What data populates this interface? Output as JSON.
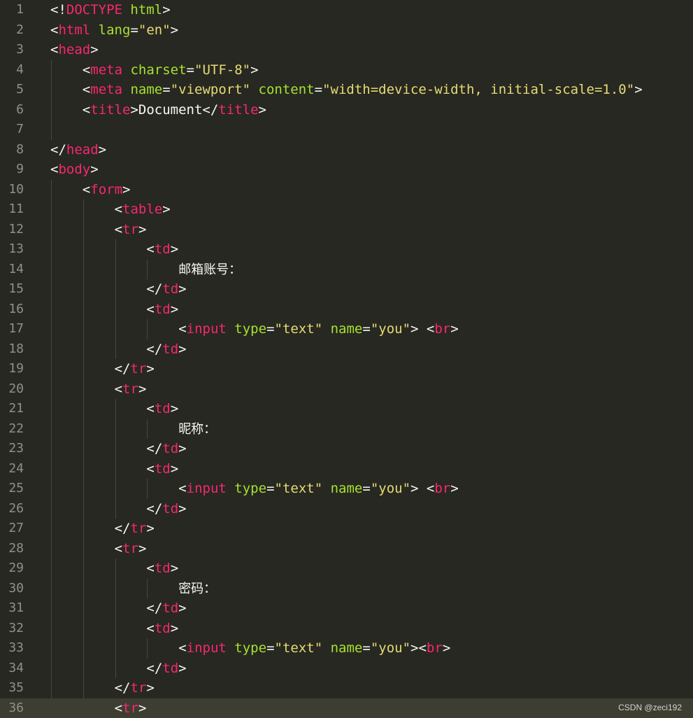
{
  "editor": {
    "language": "html",
    "current_line": 36,
    "lines": [
      {
        "n": "1",
        "indent": 0,
        "tokens": [
          {
            "t": "punct",
            "v": "<!"
          },
          {
            "t": "tag",
            "v": "DOCTYPE"
          },
          {
            "t": "punct",
            "v": " "
          },
          {
            "t": "attr",
            "v": "html"
          },
          {
            "t": "punct",
            "v": ">"
          }
        ]
      },
      {
        "n": "2",
        "indent": 0,
        "tokens": [
          {
            "t": "punct",
            "v": "<"
          },
          {
            "t": "tag",
            "v": "html"
          },
          {
            "t": "punct",
            "v": " "
          },
          {
            "t": "attr",
            "v": "lang"
          },
          {
            "t": "punct",
            "v": "="
          },
          {
            "t": "str",
            "v": "\"en\""
          },
          {
            "t": "punct",
            "v": ">"
          }
        ]
      },
      {
        "n": "3",
        "indent": 0,
        "tokens": [
          {
            "t": "punct",
            "v": "<"
          },
          {
            "t": "tag",
            "v": "head"
          },
          {
            "t": "punct",
            "v": ">"
          }
        ]
      },
      {
        "n": "4",
        "indent": 1,
        "tokens": [
          {
            "t": "punct",
            "v": "<"
          },
          {
            "t": "tag",
            "v": "meta"
          },
          {
            "t": "punct",
            "v": " "
          },
          {
            "t": "attr",
            "v": "charset"
          },
          {
            "t": "punct",
            "v": "="
          },
          {
            "t": "str",
            "v": "\"UTF-8\""
          },
          {
            "t": "punct",
            "v": ">"
          }
        ]
      },
      {
        "n": "5",
        "indent": 1,
        "tokens": [
          {
            "t": "punct",
            "v": "<"
          },
          {
            "t": "tag",
            "v": "meta"
          },
          {
            "t": "punct",
            "v": " "
          },
          {
            "t": "attr",
            "v": "name"
          },
          {
            "t": "punct",
            "v": "="
          },
          {
            "t": "str",
            "v": "\"viewport\""
          },
          {
            "t": "punct",
            "v": " "
          },
          {
            "t": "attr",
            "v": "content"
          },
          {
            "t": "punct",
            "v": "="
          },
          {
            "t": "str",
            "v": "\"width=device-width, initial-scale=1.0\""
          },
          {
            "t": "punct",
            "v": ">"
          }
        ]
      },
      {
        "n": "6",
        "indent": 1,
        "tokens": [
          {
            "t": "punct",
            "v": "<"
          },
          {
            "t": "tag",
            "v": "title"
          },
          {
            "t": "punct",
            "v": ">"
          },
          {
            "t": "text",
            "v": "Document"
          },
          {
            "t": "punct",
            "v": "</"
          },
          {
            "t": "tag",
            "v": "title"
          },
          {
            "t": "punct",
            "v": ">"
          }
        ]
      },
      {
        "n": "7",
        "indent": 1,
        "tokens": []
      },
      {
        "n": "8",
        "indent": 0,
        "tokens": [
          {
            "t": "punct",
            "v": "</"
          },
          {
            "t": "tag",
            "v": "head"
          },
          {
            "t": "punct",
            "v": ">"
          }
        ]
      },
      {
        "n": "9",
        "indent": 0,
        "tokens": [
          {
            "t": "punct",
            "v": "<"
          },
          {
            "t": "tag",
            "v": "body"
          },
          {
            "t": "punct",
            "v": ">"
          }
        ]
      },
      {
        "n": "10",
        "indent": 1,
        "tokens": [
          {
            "t": "punct",
            "v": "<"
          },
          {
            "t": "tag",
            "v": "form"
          },
          {
            "t": "punct",
            "v": ">"
          }
        ]
      },
      {
        "n": "11",
        "indent": 2,
        "tokens": [
          {
            "t": "punct",
            "v": "<"
          },
          {
            "t": "tag",
            "v": "table"
          },
          {
            "t": "punct",
            "v": ">"
          }
        ]
      },
      {
        "n": "12",
        "indent": 2,
        "tokens": [
          {
            "t": "punct",
            "v": "<"
          },
          {
            "t": "tag",
            "v": "tr"
          },
          {
            "t": "punct",
            "v": ">"
          }
        ]
      },
      {
        "n": "13",
        "indent": 3,
        "tokens": [
          {
            "t": "punct",
            "v": "<"
          },
          {
            "t": "tag",
            "v": "td"
          },
          {
            "t": "punct",
            "v": ">"
          }
        ]
      },
      {
        "n": "14",
        "indent": 4,
        "tokens": [
          {
            "t": "cn",
            "v": "邮箱账号："
          }
        ]
      },
      {
        "n": "15",
        "indent": 3,
        "tokens": [
          {
            "t": "punct",
            "v": "</"
          },
          {
            "t": "tag",
            "v": "td"
          },
          {
            "t": "punct",
            "v": ">"
          }
        ]
      },
      {
        "n": "16",
        "indent": 3,
        "tokens": [
          {
            "t": "punct",
            "v": "<"
          },
          {
            "t": "tag",
            "v": "td"
          },
          {
            "t": "punct",
            "v": ">"
          }
        ]
      },
      {
        "n": "17",
        "indent": 4,
        "tokens": [
          {
            "t": "punct",
            "v": "<"
          },
          {
            "t": "tag",
            "v": "input"
          },
          {
            "t": "punct",
            "v": " "
          },
          {
            "t": "attr",
            "v": "type"
          },
          {
            "t": "punct",
            "v": "="
          },
          {
            "t": "str",
            "v": "\"text\""
          },
          {
            "t": "punct",
            "v": " "
          },
          {
            "t": "attr",
            "v": "name"
          },
          {
            "t": "punct",
            "v": "="
          },
          {
            "t": "str",
            "v": "\"you\""
          },
          {
            "t": "punct",
            "v": "> <"
          },
          {
            "t": "tag",
            "v": "br"
          },
          {
            "t": "punct",
            "v": ">"
          }
        ]
      },
      {
        "n": "18",
        "indent": 3,
        "tokens": [
          {
            "t": "punct",
            "v": "</"
          },
          {
            "t": "tag",
            "v": "td"
          },
          {
            "t": "punct",
            "v": ">"
          }
        ]
      },
      {
        "n": "19",
        "indent": 2,
        "tokens": [
          {
            "t": "punct",
            "v": "</"
          },
          {
            "t": "tag",
            "v": "tr"
          },
          {
            "t": "punct",
            "v": ">"
          }
        ]
      },
      {
        "n": "20",
        "indent": 2,
        "tokens": [
          {
            "t": "punct",
            "v": "<"
          },
          {
            "t": "tag",
            "v": "tr"
          },
          {
            "t": "punct",
            "v": ">"
          }
        ]
      },
      {
        "n": "21",
        "indent": 3,
        "tokens": [
          {
            "t": "punct",
            "v": "<"
          },
          {
            "t": "tag",
            "v": "td"
          },
          {
            "t": "punct",
            "v": ">"
          }
        ]
      },
      {
        "n": "22",
        "indent": 4,
        "tokens": [
          {
            "t": "cn",
            "v": "昵称："
          }
        ]
      },
      {
        "n": "23",
        "indent": 3,
        "tokens": [
          {
            "t": "punct",
            "v": "</"
          },
          {
            "t": "tag",
            "v": "td"
          },
          {
            "t": "punct",
            "v": ">"
          }
        ]
      },
      {
        "n": "24",
        "indent": 3,
        "tokens": [
          {
            "t": "punct",
            "v": "<"
          },
          {
            "t": "tag",
            "v": "td"
          },
          {
            "t": "punct",
            "v": ">"
          }
        ]
      },
      {
        "n": "25",
        "indent": 4,
        "tokens": [
          {
            "t": "punct",
            "v": "<"
          },
          {
            "t": "tag",
            "v": "input"
          },
          {
            "t": "punct",
            "v": " "
          },
          {
            "t": "attr",
            "v": "type"
          },
          {
            "t": "punct",
            "v": "="
          },
          {
            "t": "str",
            "v": "\"text\""
          },
          {
            "t": "punct",
            "v": " "
          },
          {
            "t": "attr",
            "v": "name"
          },
          {
            "t": "punct",
            "v": "="
          },
          {
            "t": "str",
            "v": "\"you\""
          },
          {
            "t": "punct",
            "v": "> <"
          },
          {
            "t": "tag",
            "v": "br"
          },
          {
            "t": "punct",
            "v": ">"
          }
        ]
      },
      {
        "n": "26",
        "indent": 3,
        "tokens": [
          {
            "t": "punct",
            "v": "</"
          },
          {
            "t": "tag",
            "v": "td"
          },
          {
            "t": "punct",
            "v": ">"
          }
        ]
      },
      {
        "n": "27",
        "indent": 2,
        "tokens": [
          {
            "t": "punct",
            "v": "</"
          },
          {
            "t": "tag",
            "v": "tr"
          },
          {
            "t": "punct",
            "v": ">"
          }
        ]
      },
      {
        "n": "28",
        "indent": 2,
        "tokens": [
          {
            "t": "punct",
            "v": "<"
          },
          {
            "t": "tag",
            "v": "tr"
          },
          {
            "t": "punct",
            "v": ">"
          }
        ]
      },
      {
        "n": "29",
        "indent": 3,
        "tokens": [
          {
            "t": "punct",
            "v": "<"
          },
          {
            "t": "tag",
            "v": "td"
          },
          {
            "t": "punct",
            "v": ">"
          }
        ]
      },
      {
        "n": "30",
        "indent": 4,
        "tokens": [
          {
            "t": "cn",
            "v": "密码："
          }
        ]
      },
      {
        "n": "31",
        "indent": 3,
        "tokens": [
          {
            "t": "punct",
            "v": "</"
          },
          {
            "t": "tag",
            "v": "td"
          },
          {
            "t": "punct",
            "v": ">"
          }
        ]
      },
      {
        "n": "32",
        "indent": 3,
        "tokens": [
          {
            "t": "punct",
            "v": "<"
          },
          {
            "t": "tag",
            "v": "td"
          },
          {
            "t": "punct",
            "v": ">"
          }
        ]
      },
      {
        "n": "33",
        "indent": 4,
        "tokens": [
          {
            "t": "punct",
            "v": "<"
          },
          {
            "t": "tag",
            "v": "input"
          },
          {
            "t": "punct",
            "v": " "
          },
          {
            "t": "attr",
            "v": "type"
          },
          {
            "t": "punct",
            "v": "="
          },
          {
            "t": "str",
            "v": "\"text\""
          },
          {
            "t": "punct",
            "v": " "
          },
          {
            "t": "attr",
            "v": "name"
          },
          {
            "t": "punct",
            "v": "="
          },
          {
            "t": "str",
            "v": "\"you\""
          },
          {
            "t": "punct",
            "v": "><"
          },
          {
            "t": "tag",
            "v": "br"
          },
          {
            "t": "punct",
            "v": ">"
          }
        ]
      },
      {
        "n": "34",
        "indent": 3,
        "tokens": [
          {
            "t": "punct",
            "v": "</"
          },
          {
            "t": "tag",
            "v": "td"
          },
          {
            "t": "punct",
            "v": ">"
          }
        ]
      },
      {
        "n": "35",
        "indent": 2,
        "tokens": [
          {
            "t": "punct",
            "v": "</"
          },
          {
            "t": "tag",
            "v": "tr"
          },
          {
            "t": "punct",
            "v": ">"
          }
        ]
      },
      {
        "n": "36",
        "indent": 2,
        "tokens": [
          {
            "t": "punct",
            "v": "<"
          },
          {
            "t": "tag",
            "v": "tr"
          },
          {
            "t": "punct",
            "v": ">"
          }
        ]
      }
    ]
  },
  "watermark": "CSDN @zeci192",
  "colors": {
    "background": "#272822",
    "current_line": "#3e3d32",
    "gutter_text": "#90908a",
    "tag": "#f92672",
    "attribute": "#a6e22e",
    "string": "#e6db74",
    "text": "#f8f8f2"
  }
}
